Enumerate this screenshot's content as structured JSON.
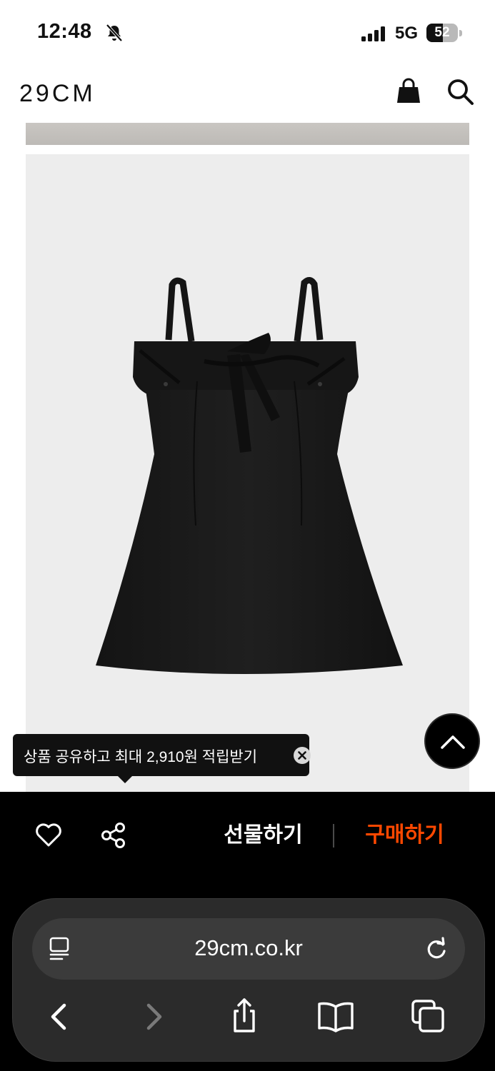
{
  "status_bar": {
    "time": "12:48",
    "network": "5G",
    "battery_level": "52",
    "battery_fraction": 0.52
  },
  "header": {
    "logo": "29CM"
  },
  "tooltip": {
    "text": "상품 공유하고 최대 2,910원 적립받기"
  },
  "purchase_bar": {
    "gift_label": "선물하기",
    "buy_label": "구매하기",
    "buy_color": "#ff4800"
  },
  "browser": {
    "url": "29cm.co.kr"
  },
  "icons": {
    "status": [
      "bell-slash-icon",
      "signal-icon"
    ],
    "header": [
      "shopping-bag-icon",
      "search-icon"
    ],
    "purchase": [
      "heart-icon",
      "share-icon"
    ],
    "browser": [
      "reader-icon",
      "reload-icon",
      "back-icon",
      "forward-icon",
      "share-sheet-icon",
      "bookmarks-icon",
      "tabs-icon"
    ]
  }
}
